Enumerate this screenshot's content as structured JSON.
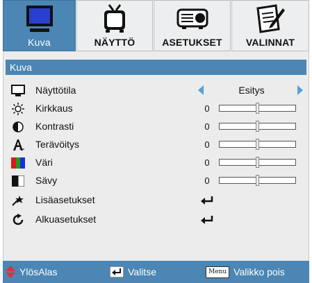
{
  "tabs": [
    {
      "label": "Kuva",
      "icon": "monitor-icon",
      "active": true
    },
    {
      "label": "NÄYTTÖ",
      "icon": "tv-icon",
      "active": false
    },
    {
      "label": "ASETUKSET",
      "icon": "projector-icon",
      "active": false
    },
    {
      "label": "VALINNAT",
      "icon": "checklist-icon",
      "active": false
    }
  ],
  "section": {
    "title": "Kuva"
  },
  "rows": [
    {
      "label": "Näyttötila",
      "icon": "display-mode-icon",
      "type": "select",
      "value": "Esitys"
    },
    {
      "label": "Kirkkaus",
      "icon": "brightness-icon",
      "type": "slider",
      "value": "0",
      "level": 0.5
    },
    {
      "label": "Kontrasti",
      "icon": "contrast-icon",
      "type": "slider",
      "value": "0",
      "level": 0.5
    },
    {
      "label": "Terävöitys",
      "icon": "sharpness-icon",
      "type": "slider",
      "value": "0",
      "level": 0.5
    },
    {
      "label": "Väri",
      "icon": "color-icon",
      "type": "slider",
      "value": "0",
      "level": 0.5
    },
    {
      "label": "Sävy",
      "icon": "tint-icon",
      "type": "slider",
      "value": "0",
      "level": 0.5
    },
    {
      "label": "Lisäasetukset",
      "icon": "advanced-icon",
      "type": "enter"
    },
    {
      "label": "Alkuasetukset",
      "icon": "reset-icon",
      "type": "enter"
    }
  ],
  "footer": {
    "updown": "YlösAlas",
    "select": "Valitse",
    "menu_key": "Menu",
    "exit": "Valikko pois"
  },
  "colors": {
    "accent": "#4b86b4",
    "arrow": "#5a9fd6",
    "footer_arrow": "#e0303a"
  }
}
